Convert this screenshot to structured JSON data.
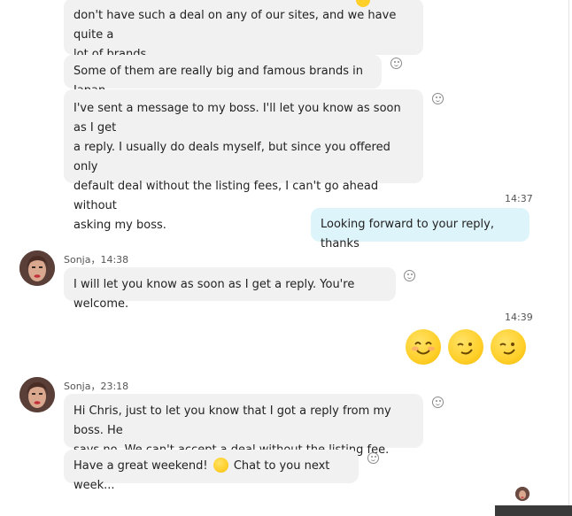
{
  "messages": {
    "m1_line1": "don't have such a deal on any of our sites, and we have quite a",
    "m1_line2": "lot of brands.",
    "m2": "Some of them are really big and famous brands in Japan.",
    "m3_line1": "I've sent a message to my boss. I'll let you know as soon as I get",
    "m3_line2": "a reply. I usually do deals myself, but since you offered only",
    "m3_line3": "default deal without the listing fees, I can't go ahead without",
    "m3_line4": "asking my boss.",
    "time_1437": "14:37",
    "mine_reply": "Looking forward to your reply, thanks",
    "sender_1438": "Sonja，14:38",
    "m4": "I will let you know as soon as I get a reply. You're welcome.",
    "time_1439": "14:39",
    "sender_2318": "Sonja，23:18",
    "m5_line1": "Hi Chris, just to let you know that I got a reply from my boss. He",
    "m5_line2": "says no. We can't accept a deal without the listing fee.",
    "m6_part1": "Have a great weekend!",
    "m6_part2": "Chat to you next week..."
  },
  "icons": {
    "reaction": "smiley-reaction-icon",
    "emoji_grin": "grinning-emoji",
    "emoji_wink": "winking-emoji",
    "emoji_smile": "smile-emoji",
    "avatar": "sonja-avatar"
  },
  "colors": {
    "incoming_bubble": "#f1f1f1",
    "outgoing_bubble": "#def4fb",
    "emoji_yellow": "#ffcf2a"
  }
}
